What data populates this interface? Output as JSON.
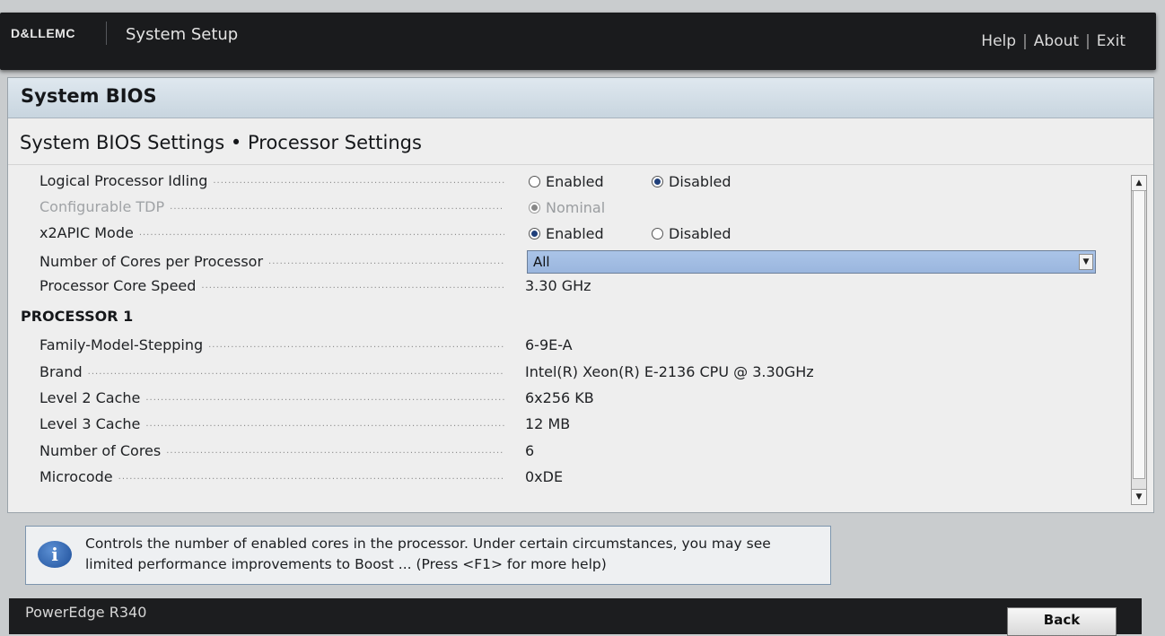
{
  "header": {
    "brand": "D&LLEMC",
    "app_title": "System Setup",
    "links": [
      "Help",
      "About",
      "Exit"
    ]
  },
  "panel": {
    "title": "System BIOS",
    "section_title": "System BIOS Settings • Processor Settings"
  },
  "settings": {
    "logical_idling": {
      "label": "Logical Processor Idling",
      "options": [
        "Enabled",
        "Disabled"
      ],
      "selected": "Disabled"
    },
    "configurable_tdp": {
      "label": "Configurable TDP",
      "option": "Nominal",
      "selected": "Nominal",
      "disabled": true
    },
    "x2apic": {
      "label": "x2APIC Mode",
      "options": [
        "Enabled",
        "Disabled"
      ],
      "selected": "Enabled"
    },
    "cores_per_processor": {
      "label": "Number of Cores per Processor",
      "value": "All"
    },
    "core_speed": {
      "label": "Processor Core Speed",
      "value": "3.30 GHz"
    }
  },
  "processor1": {
    "title": "PROCESSOR 1",
    "rows": [
      {
        "label": "Family-Model-Stepping",
        "value": "6-9E-A"
      },
      {
        "label": "Brand",
        "value": "Intel(R) Xeon(R) E-2136 CPU @ 3.30GHz"
      },
      {
        "label": "Level 2 Cache",
        "value": "6x256 KB"
      },
      {
        "label": "Level 3 Cache",
        "value": "12 MB"
      },
      {
        "label": "Number of Cores",
        "value": "6"
      },
      {
        "label": "Microcode",
        "value": "0xDE"
      }
    ]
  },
  "help": {
    "text": "Controls the number of enabled cores in the processor. Under certain circumstances, you may see limited performance improvements to Boost ... (Press <F1> for more help)"
  },
  "footer": {
    "model": "PowerEdge R340",
    "back_label": "Back"
  },
  "icons": {
    "info": "info-icon",
    "dropdown": "chevron-down-icon",
    "scroll_up": "scroll-up-icon",
    "scroll_down": "scroll-down-icon"
  }
}
